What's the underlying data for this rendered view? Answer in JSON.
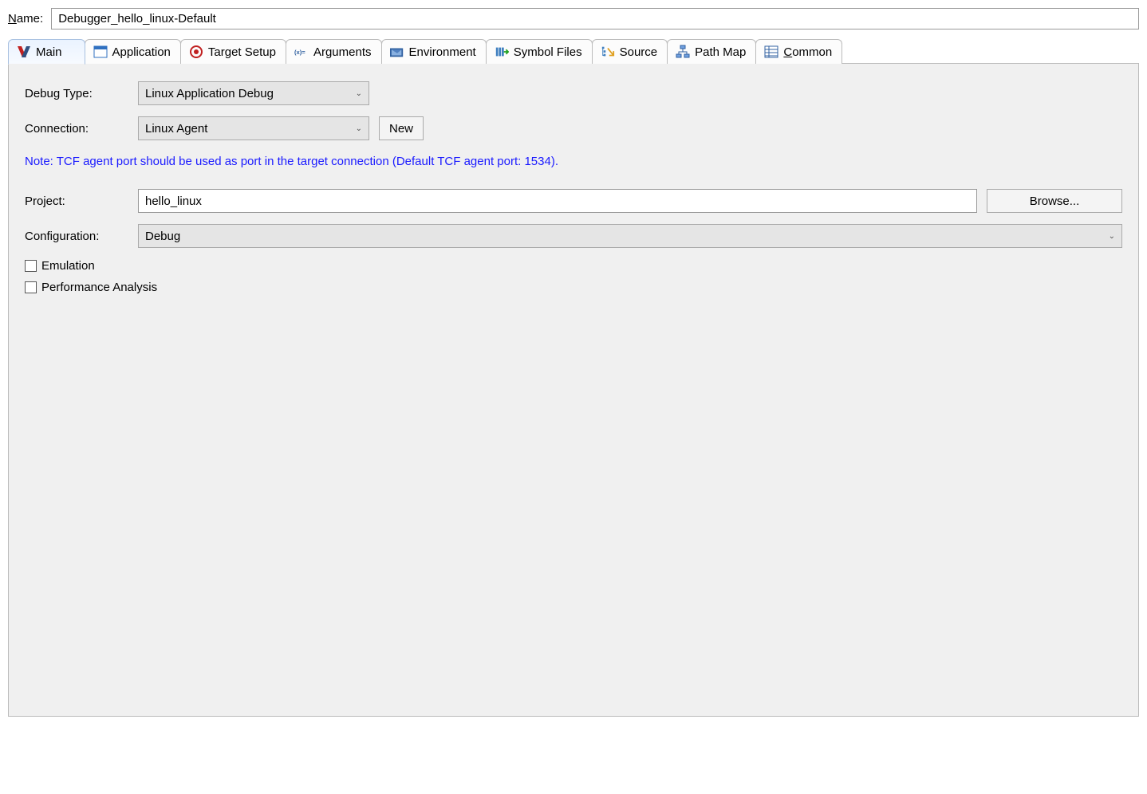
{
  "name": {
    "label_pre": "N",
    "label_post": "ame:",
    "value": "Debugger_hello_linux-Default"
  },
  "tabs": {
    "main": "Main",
    "application": "Application",
    "target_setup": "Target Setup",
    "arguments": "Arguments",
    "environment": "Environment",
    "symbol_files": "Symbol Files",
    "source": "Source",
    "path_map": "Path Map",
    "common_pre": "C",
    "common_post": "ommon"
  },
  "main_panel": {
    "debug_type_label": "Debug Type:",
    "debug_type_value": "Linux Application Debug",
    "connection_label": "Connection:",
    "connection_value": "Linux Agent",
    "new_button": "New",
    "note": "Note: TCF agent port should be used as port in the target connection (Default TCF agent port: 1534).",
    "project_label": "Project:",
    "project_value": "hello_linux",
    "browse_button": "Browse...",
    "configuration_label": "Configuration:",
    "configuration_value": "Debug",
    "emulation_label": "Emulation",
    "performance_label": "Performance Analysis"
  }
}
